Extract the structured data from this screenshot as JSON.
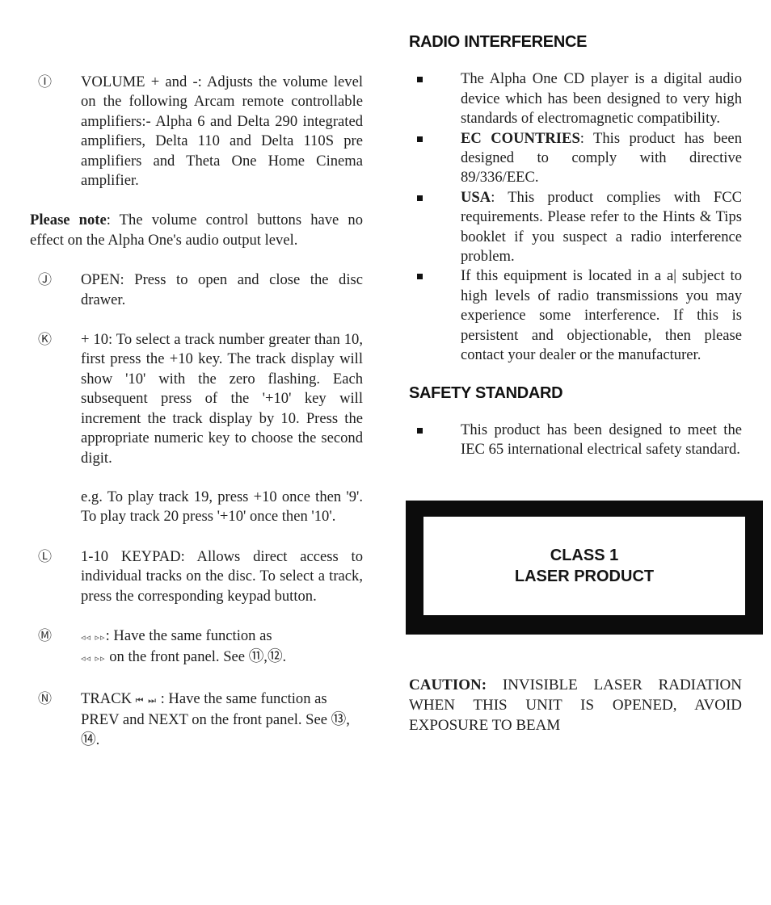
{
  "left_column": {
    "items": [
      {
        "marker": "Ⓘ",
        "paragraphs": [
          "VOLUME + and -:  Adjusts the volume level on the following Arcam remote controllable amplifiers:- Alpha 6 and Delta 290 integrated amplifiers, Delta 110 and Delta 110S pre amplifiers and Theta One Home Cinema amplifier."
        ]
      },
      {
        "marker": "Ⓙ",
        "paragraphs": [
          "OPEN:  Press to open and close the disc drawer."
        ]
      },
      {
        "marker": "Ⓚ",
        "paragraphs": [
          "+ 10:  To select a track number greater than 10, first press the +10 key.  The track display will show '10'  with the zero flashing.  Each subsequent press of the '+10' key will increment the track display by 10.  Press the appropriate numeric key to choose the second digit.",
          "e.g. To play track  19, press +10 once then '9'.  To play track 20 press '+10' once then '10'."
        ]
      },
      {
        "marker": "Ⓛ",
        "paragraphs": [
          "1-10 KEYPAD:  Allows direct access to individual tracks on the disc.  To select a track, press the corresponding keypad button."
        ]
      },
      {
        "marker": "Ⓜ",
        "glyph_a": "◃◃  ▹▹",
        "text_a": ": Have the same function as",
        "glyph_b": "◃◃  ▹▹",
        "text_b": " on the front panel.  See ⑪,⑫."
      },
      {
        "marker": "Ⓝ",
        "lead": "TRACK ",
        "glyph": "⏮ ⏭",
        "text": " : Have the same function as PREV and NEXT on the front panel.  See ⑬, ⑭."
      }
    ],
    "note": {
      "label": "Please note",
      "text": ":  The volume control buttons have no effect on the Alpha One's audio output level."
    }
  },
  "right_column": {
    "radio": {
      "heading": "RADIO INTERFERENCE",
      "bullets": [
        {
          "lead": "",
          "text": "The Alpha One CD player is a digital audio device which has been designed to very high standards of electromagnetic compatibility."
        },
        {
          "lead": "EC COUNTRIES",
          "text": ":  This product has been designed to comply with directive 89/336/EEC."
        },
        {
          "lead": "USA",
          "text": ":  This product complies with FCC requirements.  Please refer to the Hints & Tips booklet if you suspect a radio interference problem."
        },
        {
          "lead": "",
          "text": "If this equipment is located in a a| subject to high levels of radio transmissions you may experience some interference.  If this is persistent and objectionable, then please contact your dealer or the manufacturer."
        }
      ]
    },
    "safety": {
      "heading": "SAFETY STANDARD",
      "bullets": [
        {
          "text": "This product has been designed to meet the IEC 65 international electrical safety standard."
        }
      ]
    },
    "laser_label": {
      "line1": "CLASS 1",
      "line2": "LASER PRODUCT"
    },
    "caution": {
      "label": "CAUTION:",
      "text": " INVISIBLE LASER RADIATION WHEN THIS UNIT IS OPENED, AVOID EXPOSURE TO BEAM"
    }
  }
}
